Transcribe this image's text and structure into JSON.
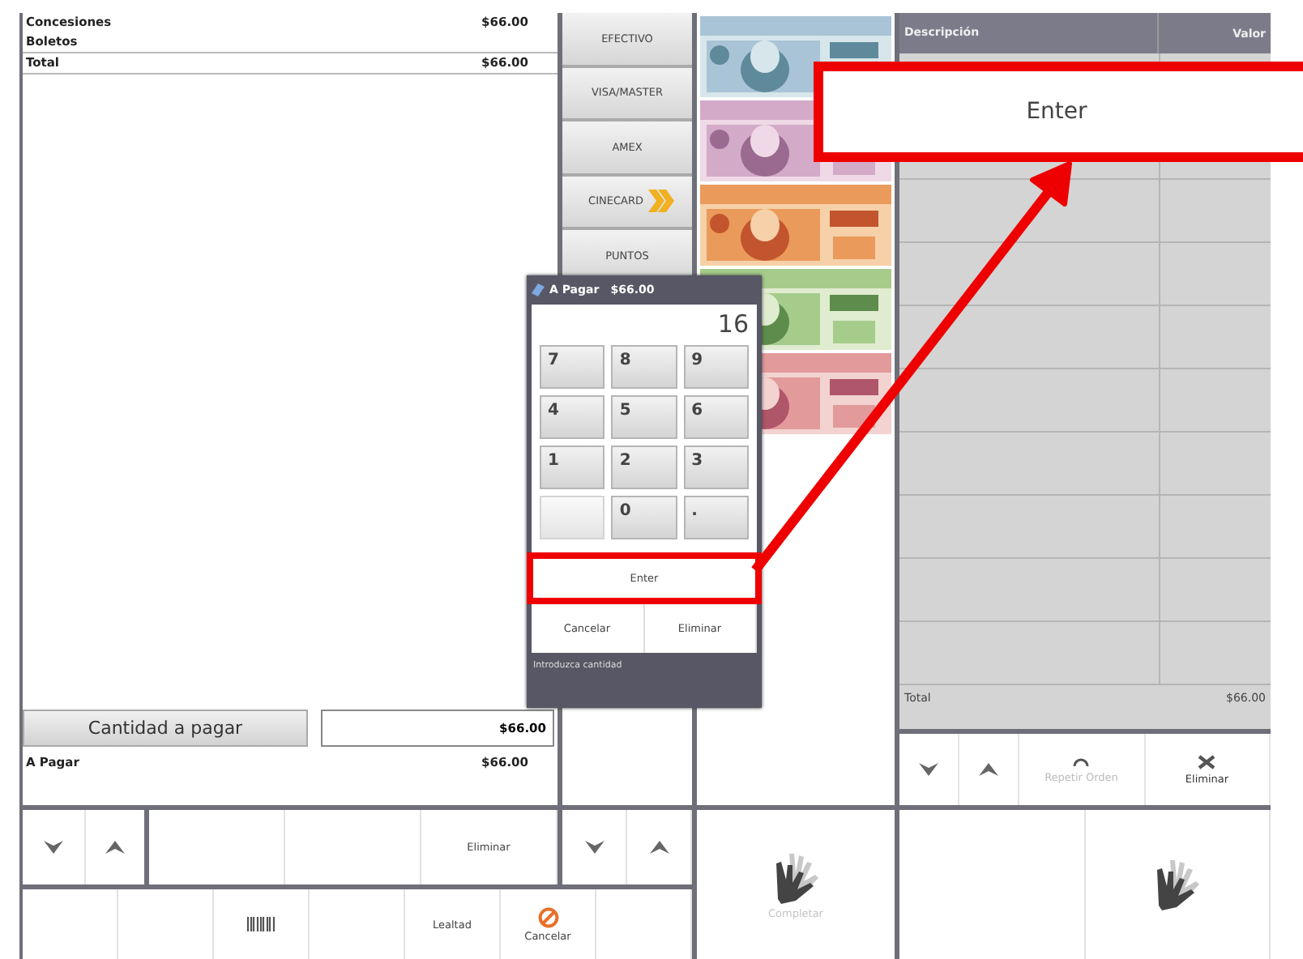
{
  "receipt": {
    "lines": [
      {
        "label": "Concesiones",
        "amount": "$66.00"
      },
      {
        "label": "Boletos"
      }
    ],
    "total": {
      "label": "Total",
      "amount": "$66.00"
    },
    "amount_button": "Cantidad a pagar",
    "amount_field": "$66.00",
    "due": {
      "label": "A Pagar",
      "amount": "$66.00"
    }
  },
  "payment_methods": [
    {
      "label": "EFECTIVO",
      "chevron": false
    },
    {
      "label": "VISA/MASTER",
      "chevron": false
    },
    {
      "label": "AMEX",
      "chevron": false
    },
    {
      "label": "CINECARD",
      "chevron": true
    },
    {
      "label": "PUNTOS",
      "chevron": false
    }
  ],
  "payments_table": {
    "columns": [
      "Descripción",
      "Valor"
    ],
    "total": {
      "label": "Total",
      "amount": "$66.00"
    },
    "toolbar": [
      {
        "kind": "down"
      },
      {
        "kind": "up"
      },
      {
        "kind": "repeat",
        "label": "Repetir Orden",
        "disabled": true
      },
      {
        "kind": "delete",
        "label": "Eliminar",
        "disabled": false
      }
    ]
  },
  "item_toolbar": [
    {
      "kind": "down"
    },
    {
      "kind": "up"
    },
    {
      "kind": "blank"
    },
    {
      "kind": "blank"
    },
    {
      "kind": "text",
      "label": "Eliminar"
    }
  ],
  "method_toolbar": [
    {
      "kind": "down"
    },
    {
      "kind": "up"
    }
  ],
  "complete_button": {
    "label": "Completar",
    "disabled": true
  },
  "right_actions": [
    {
      "kind": "blank"
    },
    {
      "kind": "hand"
    }
  ],
  "bottom_bar": [
    {
      "kind": "blank"
    },
    {
      "kind": "blank"
    },
    {
      "kind": "barcode"
    },
    {
      "kind": "blank"
    },
    {
      "kind": "text",
      "label": "Lealtad"
    },
    {
      "kind": "cancel",
      "label": "Cancelar"
    },
    {
      "kind": "blank"
    }
  ],
  "dialog": {
    "title": "A Pagar",
    "amount": "$66.00",
    "display": "16",
    "keys": [
      {
        "label": "7",
        "disabled": false
      },
      {
        "label": "8",
        "disabled": false
      },
      {
        "label": "9",
        "disabled": false
      },
      {
        "label": "4",
        "disabled": false
      },
      {
        "label": "5",
        "disabled": false
      },
      {
        "label": "6",
        "disabled": false
      },
      {
        "label": "1",
        "disabled": false
      },
      {
        "label": "2",
        "disabled": false
      },
      {
        "label": "3",
        "disabled": false
      },
      {
        "disabled": true
      },
      {
        "label": "0",
        "disabled": false
      },
      {
        "label": ".",
        "disabled": false
      }
    ],
    "enter": "Enter",
    "actions": [
      "Cancelar",
      "Eliminar"
    ],
    "hint": "Introduzca cantidad"
  },
  "callout": {
    "label": "Enter"
  }
}
